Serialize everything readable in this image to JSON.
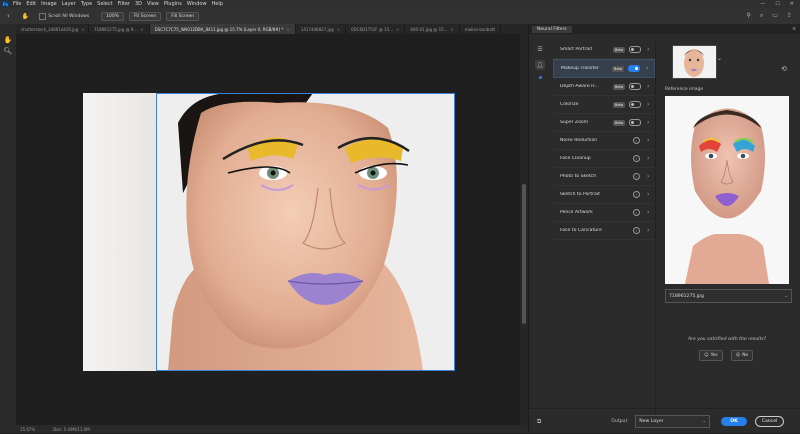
{
  "app": {
    "logo": "Ps"
  },
  "menu": [
    "File",
    "Edit",
    "Image",
    "Layer",
    "Type",
    "Select",
    "Filter",
    "3D",
    "View",
    "Plugins",
    "Window",
    "Help"
  ],
  "window_controls": {
    "minimize": "—",
    "maximize": "☐",
    "close": "✕"
  },
  "options_bar": {
    "scroll_all_windows": "Scroll All Windows",
    "zoom_100": "100%",
    "fit_screen": "Fit Screen",
    "fill_screen": "Fill Screen"
  },
  "tabs": [
    {
      "label": "shutterstock_346914426.jpg"
    },
    {
      "label": "718961275.jpg @ 9..."
    },
    {
      "label": "DSC7C7C75_WA012DBA_8411.jpg @ 15.7% (Layer 0, RGB/8#) *",
      "active": true
    },
    {
      "label": "1417446827.jpg"
    },
    {
      "label": "6DC6D1751F @ 15..."
    },
    {
      "label": "600-01.jpg @ 15..."
    },
    {
      "label": "malise-banbott"
    }
  ],
  "status": {
    "zoom": "15.67%",
    "doc": "Doc: 5.49M/11.0M"
  },
  "panel": {
    "title": "Neural Filters",
    "filters": [
      {
        "name": "Smart Portrait",
        "beta": "Beta",
        "control": "toggle",
        "on": false
      },
      {
        "name": "Makeup Transfer",
        "beta": "Beta",
        "control": "toggle",
        "on": true,
        "active": true
      },
      {
        "name": "Depth-Aware H...",
        "beta": "Beta",
        "control": "toggle",
        "on": false
      },
      {
        "name": "Colorize",
        "beta": "Beta",
        "control": "toggle",
        "on": false
      },
      {
        "name": "Super Zoom",
        "beta": "Beta",
        "control": "toggle",
        "on": false
      },
      {
        "name": "Noise Reduction",
        "control": "info"
      },
      {
        "name": "Face Cleanup",
        "control": "info"
      },
      {
        "name": "Photo to Sketch",
        "control": "info"
      },
      {
        "name": "Sketch to Portrait",
        "control": "info"
      },
      {
        "name": "Pencil Artwork",
        "control": "info"
      },
      {
        "name": "Face to Caricature",
        "control": "info"
      }
    ],
    "reference_label": "Reference image",
    "reference_file": "718961275.jpg",
    "satisfied_question": "Are you satisfied with the results?",
    "yes_label": "Yes",
    "no_label": "No",
    "output_label": "Output",
    "output_value": "New Layer",
    "ok_label": "OK",
    "cancel_label": "Cancel"
  },
  "colors": {
    "accent": "#2680eb",
    "selection": "#3b82d8"
  }
}
